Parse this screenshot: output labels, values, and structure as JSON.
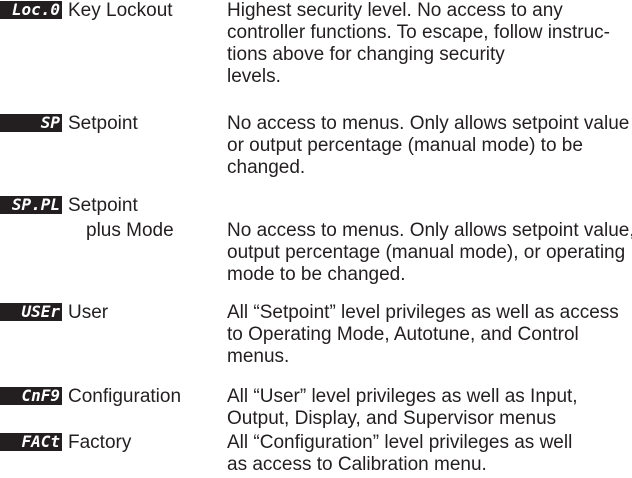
{
  "levels": [
    {
      "code": "Loc.0",
      "name": "Key Lockout",
      "description": [
        "Highest security level. No access to any",
        "controller functions. To escape, follow instruc-",
        "tions above for changing security",
        "levels."
      ]
    },
    {
      "code": "SP",
      "name": "Setpoint",
      "description": [
        "No access to menus. Only allows setpoint value",
        "or output percentage (manual mode) to be",
        "changed."
      ]
    },
    {
      "code": "SP.PL",
      "name": "Setpoint",
      "name_line2": "plus Mode",
      "description": [
        "No access to menus. Only allows setpoint value,",
        "output percentage (manual mode), or operating",
        "mode to be changed."
      ]
    },
    {
      "code": "USEr",
      "name": "User",
      "description": [
        "All “Setpoint” level privileges as well as access",
        "to Operating Mode, Autotune, and Control",
        "menus."
      ]
    },
    {
      "code": "CnF9",
      "name": "Configuration",
      "description": [
        "All “User” level privileges as well as Input,",
        "Output, Display, and Supervisor menus"
      ]
    },
    {
      "code": "FACt",
      "name": "Factory",
      "description": [
        "All “Configuration” level privileges as well",
        "as access to Calibration menu."
      ]
    }
  ]
}
